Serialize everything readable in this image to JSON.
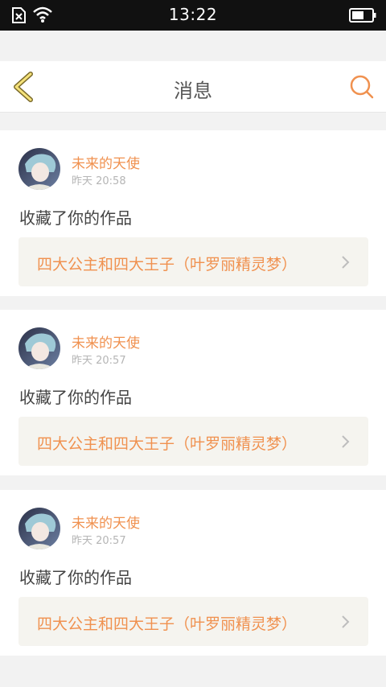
{
  "status_bar": {
    "time": "13:22",
    "icons": [
      "sim-missing-icon",
      "wifi-icon",
      "battery-icon"
    ]
  },
  "header": {
    "title": "消息",
    "back_icon": "chevron-left-icon",
    "search_icon": "search-icon",
    "accent_color": "#f0914f"
  },
  "messages": [
    {
      "user": "未来的天使",
      "time": "昨天 20:58",
      "action": "收藏了你的作品",
      "work_title": "四大公主和四大王子（叶罗丽精灵梦）"
    },
    {
      "user": "未来的天使",
      "time": "昨天 20:57",
      "action": "收藏了你的作品",
      "work_title": "四大公主和四大王子（叶罗丽精灵梦）"
    },
    {
      "user": "未来的天使",
      "time": "昨天 20:57",
      "action": "收藏了你的作品",
      "work_title": "四大公主和四大王子（叶罗丽精灵梦）"
    }
  ]
}
